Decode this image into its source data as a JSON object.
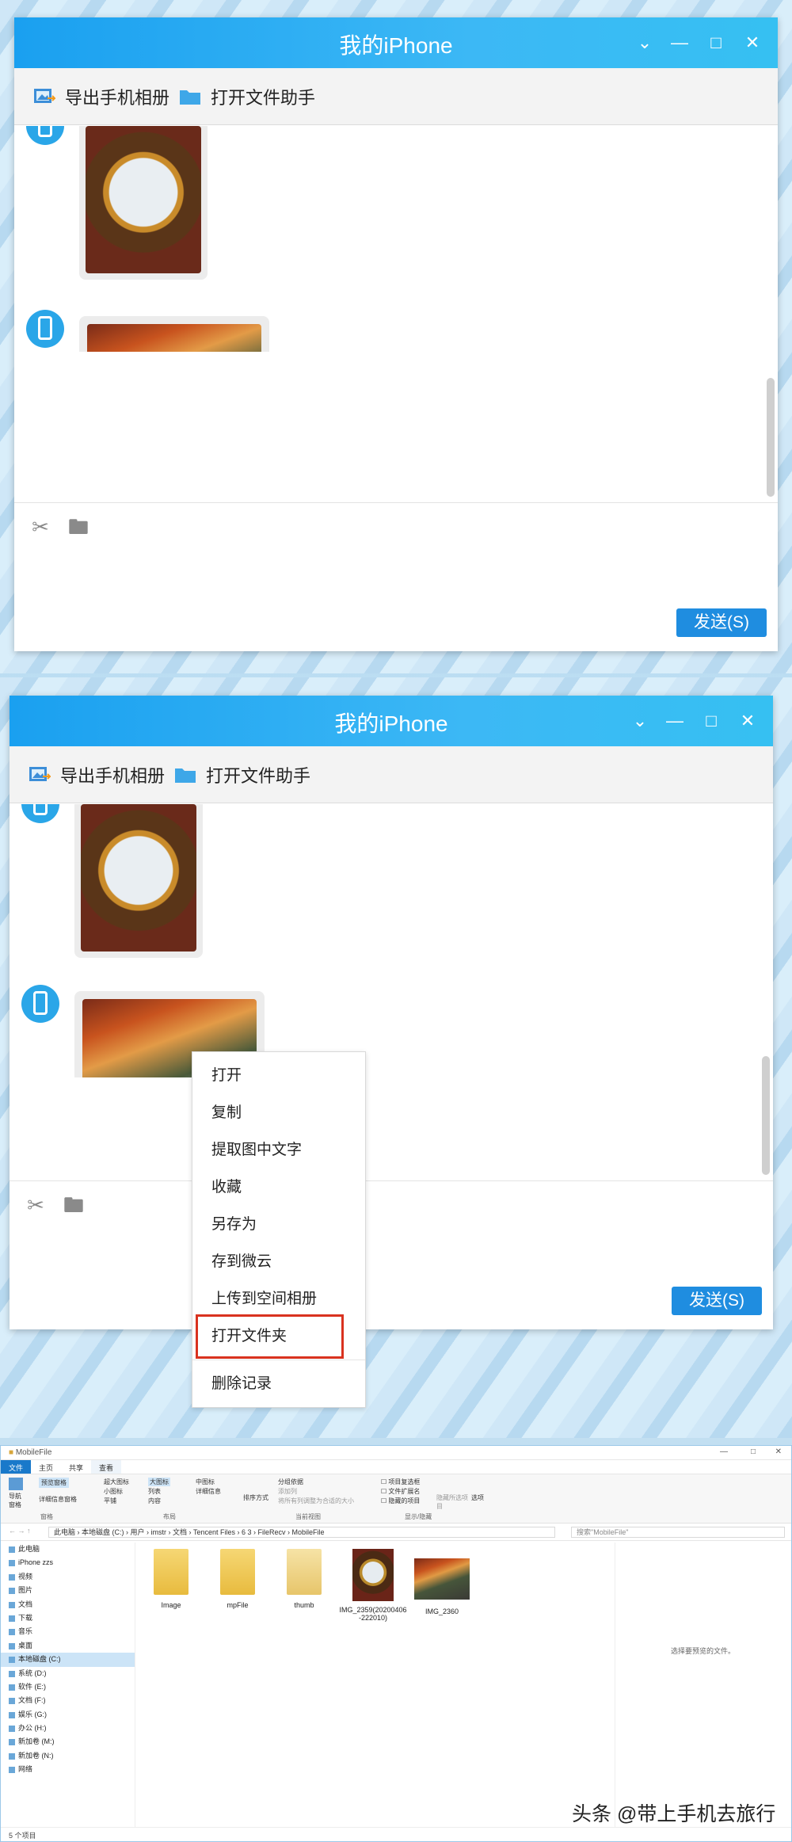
{
  "window": {
    "title": "我的iPhone",
    "export_album": "导出手机相册",
    "open_file_helper": "打开文件助手",
    "send_label": "发送(S)"
  },
  "context_menu": {
    "items": [
      "打开",
      "复制",
      "提取图中文字",
      "收藏",
      "另存为",
      "存到微云",
      "上传到空间相册",
      "打开文件夹"
    ],
    "delete": "删除记录",
    "highlighted_item": "打开文件夹"
  },
  "explorer": {
    "title": "MobileFile",
    "tabs": [
      "文件",
      "主页",
      "共享",
      "查看"
    ],
    "ribbon": {
      "nav_pane": "导航窗格",
      "preview_pane": "预览窗格",
      "details_pane": "详细信息窗格",
      "panes_group": "窗格",
      "layout_items": [
        "超大图标",
        "大图标",
        "中图标",
        "小图标",
        "列表",
        "详细信息",
        "平铺",
        "内容"
      ],
      "layout_group": "布局",
      "sort_by": "排序方式",
      "group_by": "分组依据",
      "add_column": "添加列",
      "fit_columns": "将所有列调整为合适的大小",
      "current_view_group": "当前视图",
      "item_checkboxes": "项目复选框",
      "file_extensions": "文件扩展名",
      "hidden_items": "隐藏的项目",
      "hide_selected": "隐藏所选项目",
      "show_hide_group": "显示/隐藏",
      "options": "选项"
    },
    "address": {
      "path": "此电脑 › 本地磁盘 (C:) › 用户 › imstr › 文档 › Tencent Files › 6 3 › FileRecv › MobileFile",
      "search_placeholder": "搜索\"MobileFile\""
    },
    "nav_items": [
      "此电脑",
      "iPhone zzs",
      "视频",
      "图片",
      "文档",
      "下载",
      "音乐",
      "桌面",
      "本地磁盘 (C:)",
      "系统 (D:)",
      "软件 (E:)",
      "文档 (F:)",
      "娱乐 (G:)",
      "办公 (H:)",
      "新加卷 (M:)",
      "新加卷 (N:)",
      "网络"
    ],
    "files": [
      {
        "name": "Image",
        "type": "folder"
      },
      {
        "name": "mpFile",
        "type": "folder"
      },
      {
        "name": "thumb",
        "type": "folder"
      },
      {
        "name": "IMG_2359(20200406-222010)",
        "type": "image"
      },
      {
        "name": "IMG_2360",
        "type": "image"
      }
    ],
    "preview_text": "选择要预览的文件。",
    "status": "5 个项目"
  },
  "watermark": "头条 @带上手机去旅行",
  "colors": {
    "accent": "#1aa0f0",
    "send": "#1f8de0",
    "highlight": "#d9321f"
  }
}
